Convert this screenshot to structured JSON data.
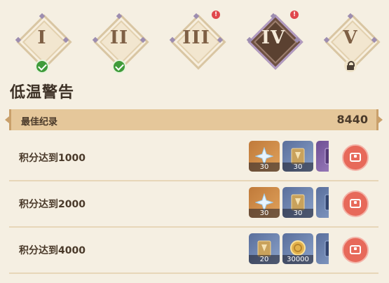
{
  "stages": [
    {
      "numeral": "I",
      "status": "completed",
      "alert": false
    },
    {
      "numeral": "II",
      "status": "completed",
      "alert": false
    },
    {
      "numeral": "III",
      "status": "open",
      "alert": true
    },
    {
      "numeral": "IV",
      "status": "selected",
      "alert": true
    },
    {
      "numeral": "V",
      "status": "locked",
      "alert": false
    }
  ],
  "alert_mark": "!",
  "title": "低温警告",
  "best_record": {
    "label": "最佳纪录",
    "value": "8440"
  },
  "milestones": [
    {
      "label": "积分达到1000",
      "rewards": [
        {
          "icon": "primogem-icon",
          "count": "30",
          "bg": "orange"
        },
        {
          "icon": "hero-wit-book-icon",
          "count": "30",
          "bg": "blue"
        },
        {
          "icon": "purple-book-icon",
          "count": "",
          "bg": "purple"
        }
      ]
    },
    {
      "label": "积分达到2000",
      "rewards": [
        {
          "icon": "primogem-icon",
          "count": "30",
          "bg": "orange"
        },
        {
          "icon": "hero-wit-book-icon",
          "count": "30",
          "bg": "blue"
        },
        {
          "icon": "blue-book-icon",
          "count": "",
          "bg": "blue"
        }
      ]
    },
    {
      "label": "积分达到4000",
      "rewards": [
        {
          "icon": "hero-wit-book-icon",
          "count": "20",
          "bg": "blue"
        },
        {
          "icon": "mora-coin-icon",
          "count": "30000",
          "bg": "blue"
        },
        {
          "icon": "blue-book-icon",
          "count": "",
          "bg": "blue"
        }
      ]
    }
  ],
  "colors": {
    "accent": "#e7695a",
    "bar": "#e5c79a",
    "background": "#f5efe2",
    "check": "#3f9b3a",
    "alert": "#e0474c"
  }
}
